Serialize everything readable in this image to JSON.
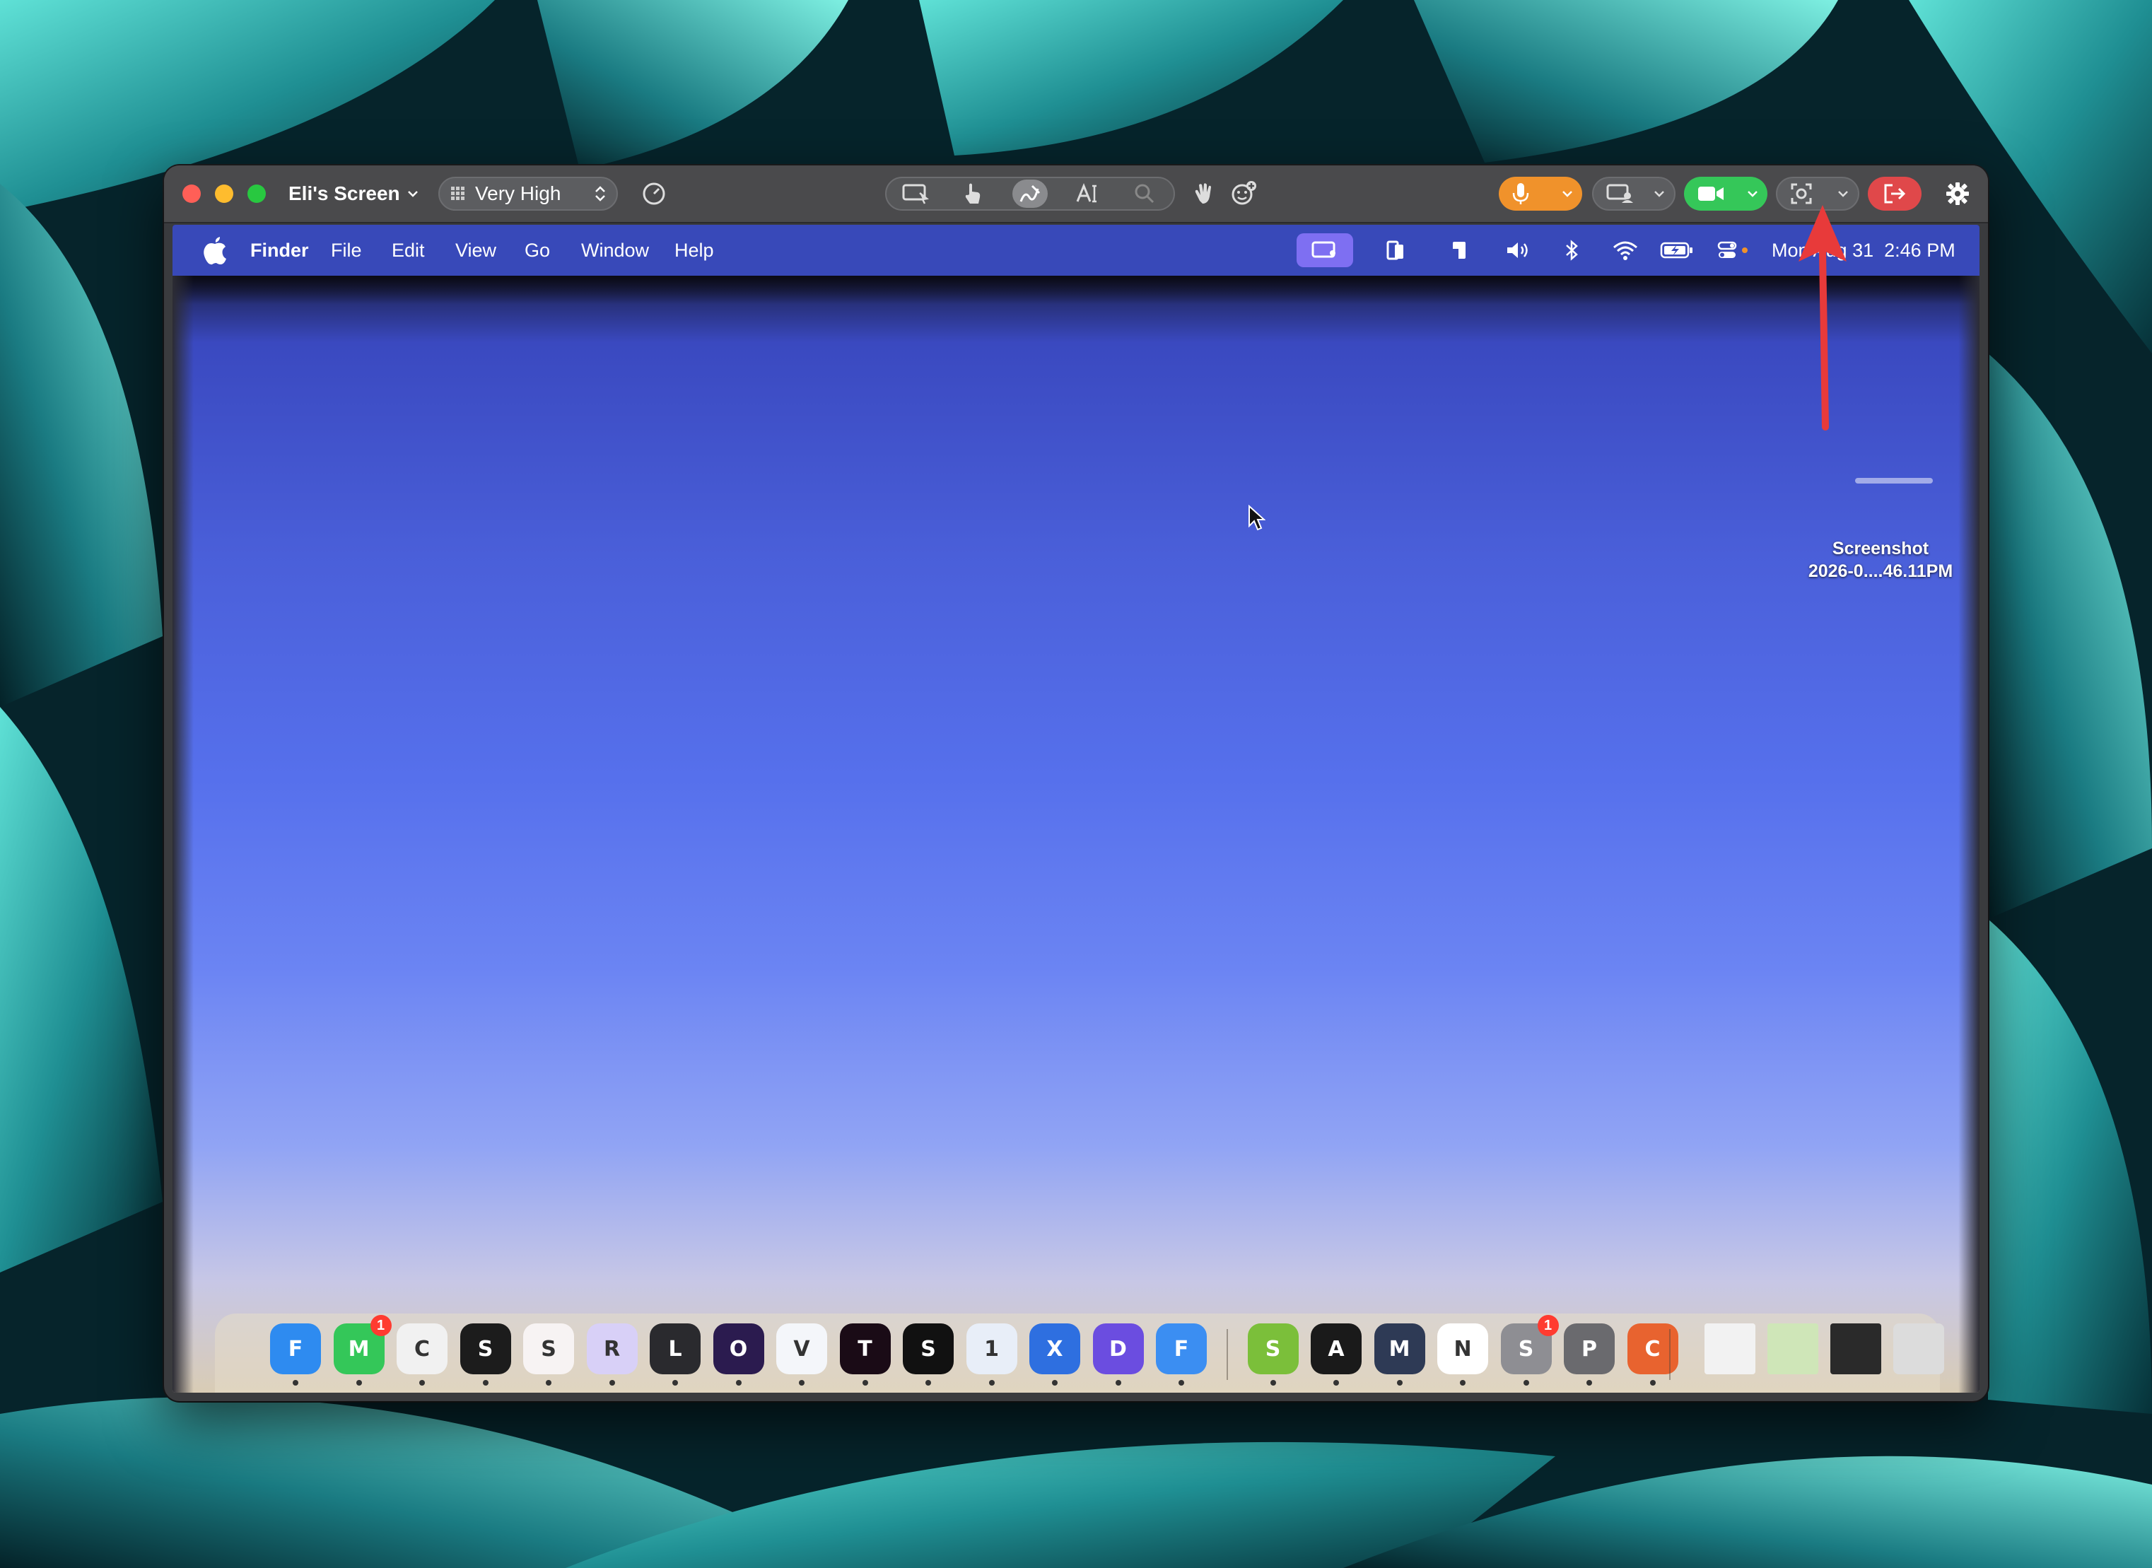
{
  "window": {
    "screen_title": "Eli's Screen",
    "quality_label": "Very High"
  },
  "remote": {
    "menubar": {
      "app_name": "Finder",
      "items": [
        "File",
        "Edit",
        "View",
        "Go",
        "Window",
        "Help"
      ],
      "clock_date": "Mon Aug 31",
      "clock_time": "2:46 PM"
    },
    "desktop_file": {
      "name_line1": "Screenshot",
      "name_line2": "2026-0....46.11PM"
    },
    "dock": {
      "apps": [
        {
          "name": "Finder",
          "color": "#2e8bf0"
        },
        {
          "name": "Messages",
          "color": "#34c759",
          "badge": "1"
        },
        {
          "name": "Chrome",
          "color": "#f1f1f1"
        },
        {
          "name": "Spotify",
          "color": "#1c1c1c"
        },
        {
          "name": "Slack",
          "color": "#f7f3f3"
        },
        {
          "name": "Reminders",
          "color": "#d8d0f7"
        },
        {
          "name": "Linear",
          "color": "#2a2a2e"
        },
        {
          "name": "Obsidian",
          "color": "#2b1b4f"
        },
        {
          "name": "VS Code",
          "color": "#f4f6fa"
        },
        {
          "name": "Terminal",
          "color": "#1a0b16"
        },
        {
          "name": "Stack",
          "color": "#111111"
        },
        {
          "name": "1Password",
          "color": "#e8eef8"
        },
        {
          "name": "Xcode",
          "color": "#2e6fe0"
        },
        {
          "name": "Docs",
          "color": "#6b4de0"
        },
        {
          "name": "Files",
          "color": "#3b8ef2"
        },
        {
          "name": "Script Editor",
          "color": "#7bbf3a"
        },
        {
          "name": "Activity Monitor",
          "color": "#1a1a1a"
        },
        {
          "name": "Marker",
          "color": "#2e3a55"
        },
        {
          "name": "Notion",
          "color": "#ffffff"
        },
        {
          "name": "System Settings",
          "color": "#8e8e93",
          "badge": "1"
        },
        {
          "name": "Phone",
          "color": "#6a6a6e"
        },
        {
          "name": "Claude",
          "color": "#e8632f"
        }
      ]
    }
  },
  "colors": {
    "annotation_arrow": "#e83a3a",
    "mic_button": "#f0922b",
    "camera_button": "#35c759",
    "leave_button": "#e0484a"
  }
}
